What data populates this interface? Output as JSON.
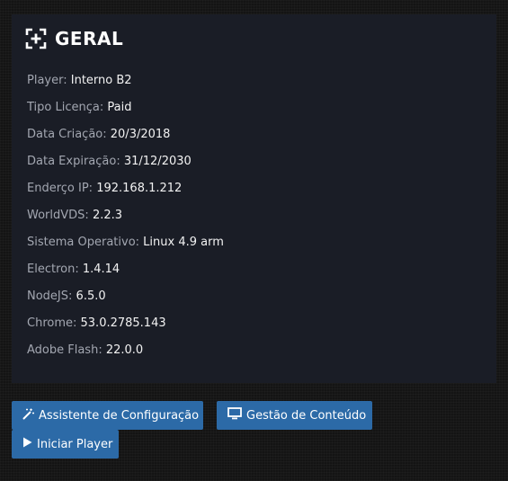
{
  "panel": {
    "title": "GERAL",
    "rows": [
      {
        "label": "Player:",
        "value": "Interno B2"
      },
      {
        "label": "Tipo Licença:",
        "value": "Paid"
      },
      {
        "label": "Data Criação:",
        "value": "20/3/2018"
      },
      {
        "label": "Data Expiração:",
        "value": "31/12/2030"
      },
      {
        "label": "Enderço IP:",
        "value": "192.168.1.212"
      },
      {
        "label": "WorldVDS:",
        "value": "2.2.3"
      },
      {
        "label": "Sistema Operativo:",
        "value": "Linux 4.9 arm"
      },
      {
        "label": "Electron:",
        "value": "1.4.14"
      },
      {
        "label": "NodeJS:",
        "value": "6.5.0"
      },
      {
        "label": "Chrome:",
        "value": "53.0.2785.143"
      },
      {
        "label": "Adobe Flash:",
        "value": "22.0.0"
      }
    ]
  },
  "buttons": {
    "wizard_label": "Assistente de Configuração",
    "content_label": "Gestão de Conteúdo",
    "start_label": "Iniciar Player"
  },
  "icons": {
    "header": "expand-plus-icon",
    "wizard": "magic-wand-icon",
    "content": "monitor-icon",
    "start": "play-icon"
  },
  "colors": {
    "page_background": "#141414",
    "panel_background": "#1a1d26",
    "label": "#a3a7b1",
    "value": "#f2f2f2",
    "button": "#2c6aa7"
  }
}
